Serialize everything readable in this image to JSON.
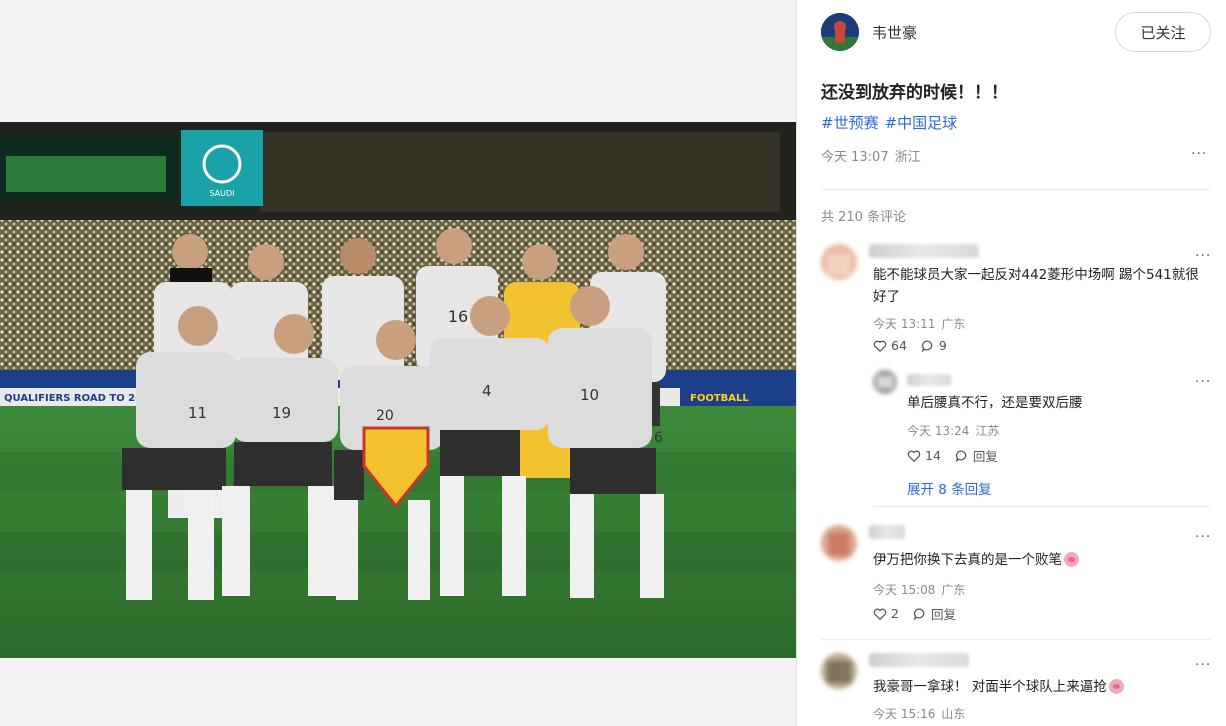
{
  "post": {
    "author_name": "韦世豪",
    "follow_label": "已关注",
    "text": "还没到放弃的时候！！！",
    "tags": [
      "#世预赛",
      "#中国足球"
    ],
    "time": "今天 13:07",
    "location": "浙江",
    "more_label": "···"
  },
  "photo": {
    "board_texts": [
      "QUALIFIERS ROAD TO 26",
      "FOOTBALL"
    ],
    "banner_text": "SAUDI",
    "jersey_numbers": [
      "11",
      "19",
      "20",
      "4",
      "10",
      "16",
      "6"
    ]
  },
  "comments_header": "共 210 条评论",
  "comments": [
    {
      "text": "能不能球员大家一起反对442菱形中场啊 踢个541就很好了",
      "time": "今天 13:11",
      "location": "广东",
      "likes": "64",
      "replies": "9",
      "reply": {
        "text": "单后腰真不行，还是要双后腰",
        "time": "今天 13:24",
        "location": "江苏",
        "likes": "14",
        "reply_label": "回复"
      },
      "expand_label": "展开 8 条回复"
    },
    {
      "text": "伊万把你换下去真的是一个败笔",
      "time": "今天 15:08",
      "location": "广东",
      "likes": "2",
      "reply_label": "回复"
    },
    {
      "text": "我豪哥一拿球！ 对面半个球队上来逼抢",
      "time": "今天 15:16",
      "location": "山东"
    }
  ]
}
